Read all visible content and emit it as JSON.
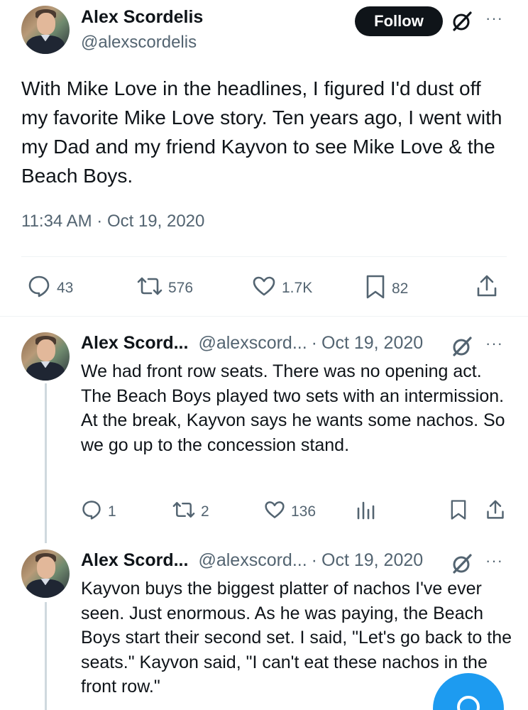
{
  "main_tweet": {
    "author_name": "Alex Scordelis",
    "author_handle": "@alexscordelis",
    "follow_label": "Follow",
    "text": "With Mike Love in the headlines, I figured I'd dust off my favorite Mike Love story. Ten years ago, I went with my Dad and my friend Kayvon to see Mike Love & the Beach Boys.",
    "timestamp": "11:34 AM · Oct 19, 2020",
    "stats": {
      "replies": "43",
      "reposts": "576",
      "likes": "1.7K",
      "bookmarks": "82"
    },
    "icons": [
      "avatar",
      "grok-icon",
      "more-icon",
      "reply-icon",
      "repost-icon",
      "like-icon",
      "bookmark-icon",
      "share-icon"
    ]
  },
  "replies": [
    {
      "author_name": "Alex Scord...",
      "author_handle": "@alexscord...",
      "separator": "·",
      "date": "Oct 19, 2020",
      "text": "We had front row seats. There was no opening act. The Beach Boys played two sets with an intermission. At the break, Kayvon says he wants some nachos. So we go up to the concession stand.",
      "stats": {
        "replies": "1",
        "reposts": "2",
        "likes": "136"
      }
    },
    {
      "author_name": "Alex Scord...",
      "author_handle": "@alexscord...",
      "separator": "·",
      "date": "Oct 19, 2020",
      "text": "Kayvon buys the biggest platter of nachos I've ever seen. Just enormous. As he was paying, the Beach Boys start their second set. I said, \"Let's go back to the seats.\" Kayvon said, \"I can't eat these nachos in the front row.\""
    }
  ],
  "more_glyph": "···",
  "colors": {
    "text_primary": "#0f1419",
    "text_secondary": "#536471",
    "follow_bg": "#0f1419",
    "fab_bg": "#1d9bf0",
    "divider": "#eff3f4",
    "thread_line": "#cfd9de"
  }
}
